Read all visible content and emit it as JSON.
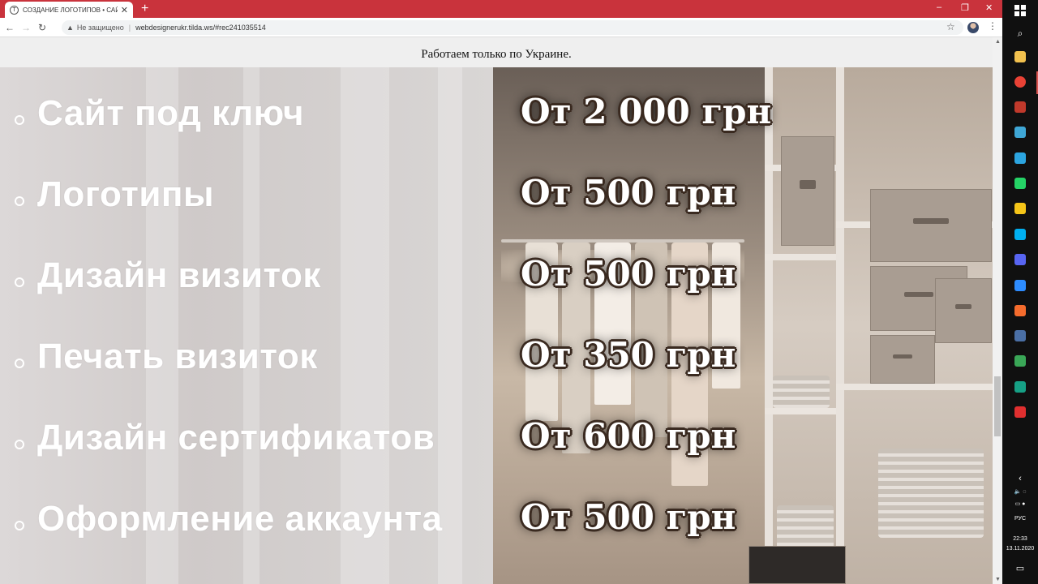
{
  "browser": {
    "tab_title": "СОЗДАНИЕ ЛОГОТИПОВ • САЙ",
    "tab_close": "✕",
    "new_tab": "+",
    "security_label": "Не защищено",
    "url": "webdesignerukr.tilda.ws/#rec241035514",
    "window_controls": [
      "–",
      "❐",
      "✕"
    ]
  },
  "page": {
    "top_notice": "Работаем только по Украине.",
    "services": [
      {
        "name": "Сайт под ключ",
        "price": "От 2 000 грн"
      },
      {
        "name": "Логотипы",
        "price": "От 500 грн"
      },
      {
        "name": "Дизайн визиток",
        "price": "От 500 грн"
      },
      {
        "name": "Печать визиток",
        "price": "От 350 грн"
      },
      {
        "name": "Дизайн сертификатов",
        "price": "От 600 грн"
      },
      {
        "name": "Оформление аккаунта",
        "price": "От 500 грн"
      }
    ]
  },
  "taskbar": {
    "language": "РУС",
    "time": "22:33",
    "date": "13.11.2020",
    "apps": [
      {
        "icon": "file-explorer-icon",
        "color": "#f2c14e"
      },
      {
        "icon": "chrome-icon",
        "color": "#e94235"
      },
      {
        "icon": "app-icon",
        "color": "#c0392b"
      },
      {
        "icon": "notes-icon",
        "color": "#3fa7d6"
      },
      {
        "icon": "telegram-icon",
        "color": "#2ca5e0"
      },
      {
        "icon": "whatsapp-icon",
        "color": "#25d366"
      },
      {
        "icon": "sticky-notes-icon",
        "color": "#f5c518"
      },
      {
        "icon": "skype-icon",
        "color": "#00aff0"
      },
      {
        "icon": "discord-icon",
        "color": "#5865f2"
      },
      {
        "icon": "zoom-icon",
        "color": "#2d8cff"
      },
      {
        "icon": "origin-icon",
        "color": "#f56c2d"
      },
      {
        "icon": "monitor-icon",
        "color": "#4a6fa5"
      },
      {
        "icon": "spreadsheet-icon",
        "color": "#3aa757"
      },
      {
        "icon": "vpn-icon",
        "color": "#16a085"
      },
      {
        "icon": "acrobat-icon",
        "color": "#e02f2f"
      }
    ]
  }
}
